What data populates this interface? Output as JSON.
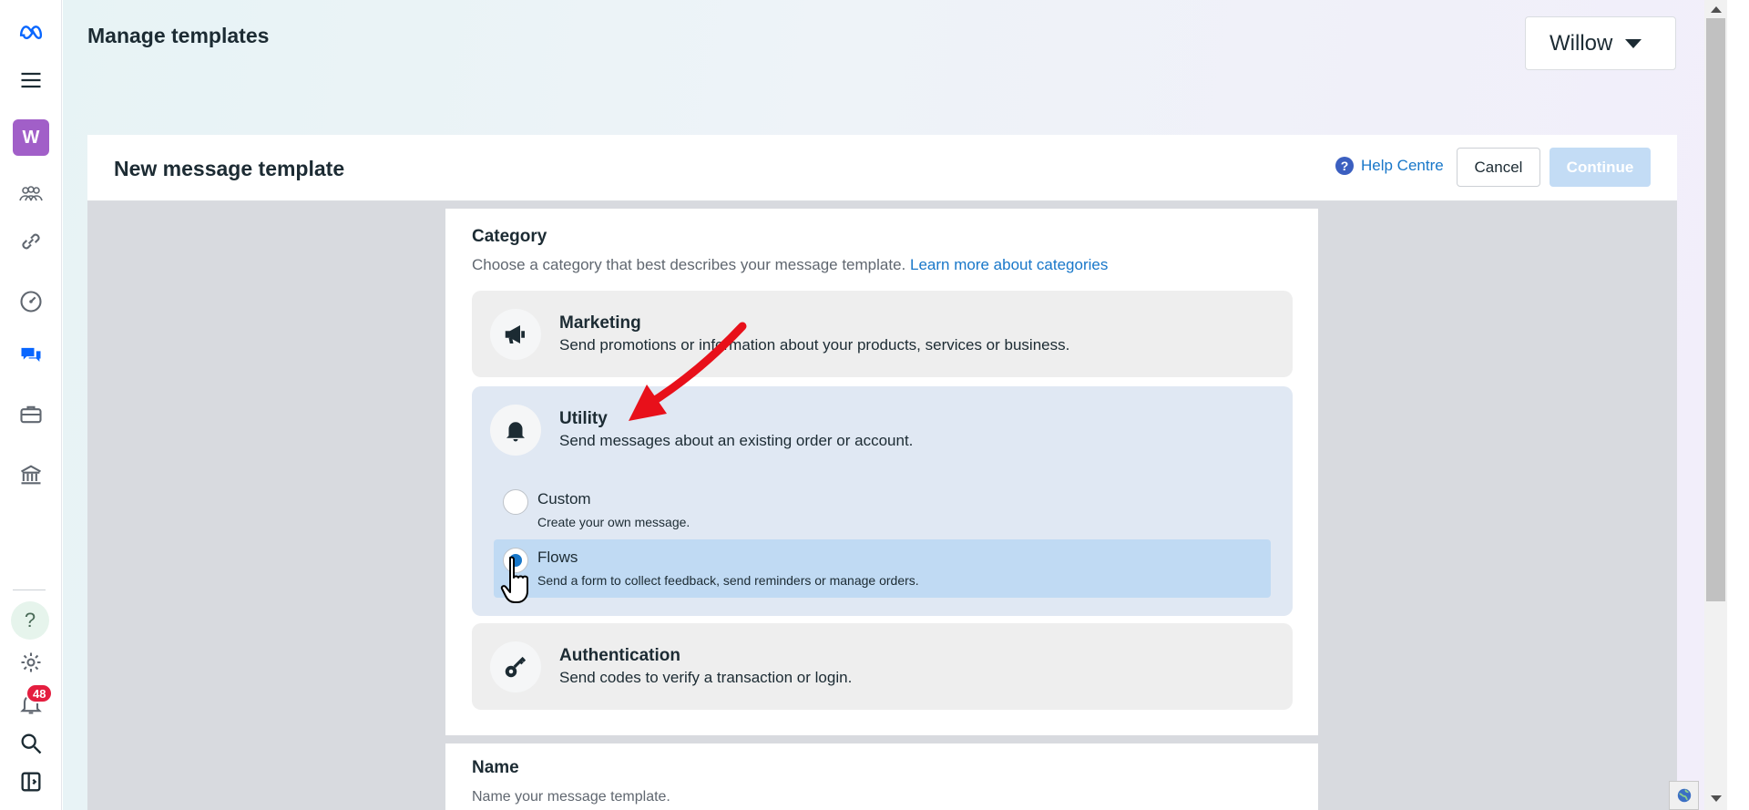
{
  "header": {
    "page_title": "Manage templates",
    "account_name": "Willow"
  },
  "rail": {
    "workspace_initial": "W",
    "notification_count": "48",
    "help_glyph": "?"
  },
  "card": {
    "title": "New message template",
    "help_link": "Help Centre",
    "cancel_label": "Cancel",
    "continue_label": "Continue"
  },
  "category": {
    "title": "Category",
    "subtitle": "Choose a category that best describes your message template.",
    "learn_more": "Learn more about categories",
    "options": [
      {
        "title": "Marketing",
        "desc": "Send promotions or information about your products, services or business.",
        "icon": "megaphone-icon"
      },
      {
        "title": "Utility",
        "desc": "Send messages about an existing order or account.",
        "icon": "bell-icon",
        "sub_options": [
          {
            "label": "Custom",
            "desc": "Create your own message.",
            "selected": false
          },
          {
            "label": "Flows",
            "desc": "Send a form to collect feedback, send reminders or manage orders.",
            "selected": true
          }
        ]
      },
      {
        "title": "Authentication",
        "desc": "Send codes to verify a transaction or login.",
        "icon": "key-icon"
      }
    ]
  },
  "name_section": {
    "title": "Name",
    "placeholder": "Name your message template."
  },
  "colors": {
    "accent": "#1877c9",
    "selected_bg": "#e0e8f3",
    "selected_sub_bg": "#c0daf3",
    "annotation_arrow": "#e8101a"
  }
}
